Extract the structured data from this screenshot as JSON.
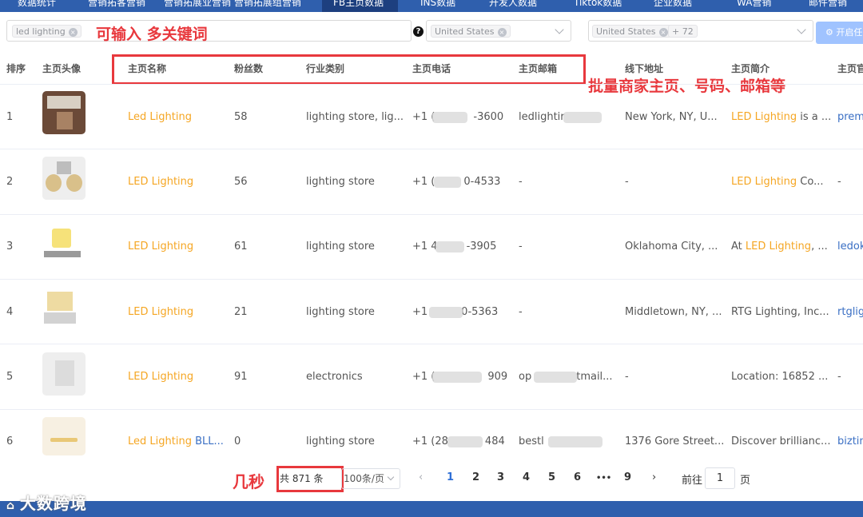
{
  "nav": {
    "tabs": [
      "数据统计",
      "营销拓客营销",
      "营销拓展业营销 营销拓展组营销",
      "FB主页数据",
      "INS数据",
      "开发人数据",
      "Tiktok数据",
      "企业数据",
      "WA营销",
      "邮件营销"
    ],
    "active_index": 3
  },
  "filters": {
    "keyword_tag": "led lighting",
    "country_select": "United States",
    "country_multi_tag": "United States",
    "country_multi_more": "+ 72",
    "start_button": "开启任"
  },
  "annotations": {
    "keywords_note": "可输入 多关键词",
    "batch_note": "批量商家主页、号码、邮箱等",
    "seconds_note": "几秒"
  },
  "table": {
    "headers": {
      "rank": "排序",
      "avatar": "主页头像",
      "name": "主页名称",
      "fans": "粉丝数",
      "industry": "行业类别",
      "phone": "主页电话",
      "email": "主页邮箱",
      "address": "线下地址",
      "intro": "主页简介",
      "homepage": "主页官"
    },
    "rows": [
      {
        "rank": "1",
        "name": "Led Lighting",
        "name_extra": "",
        "fans": "58",
        "industry": "lighting store, lig...",
        "phone_a": "+1 (",
        "phone_b": "-3600",
        "email_a": "ledlightir",
        "email_b": "",
        "address": "New York, NY, U...",
        "intro_hl": "LED Lighting",
        "intro_rest": " is a ...",
        "homepage": "prem"
      },
      {
        "rank": "2",
        "name": "LED Lighting",
        "name_extra": "",
        "fans": "56",
        "industry": "lighting store",
        "phone_a": "+1 (",
        "phone_b": "0-4533",
        "email_a": "-",
        "email_b": "",
        "address": "-",
        "intro_hl": "LED Lighting",
        "intro_rest": " Co...",
        "homepage": "-"
      },
      {
        "rank": "3",
        "name": "LED Lighting",
        "name_extra": "",
        "fans": "61",
        "industry": "lighting store",
        "phone_a": "+1 4",
        "phone_b": "-3905",
        "email_a": "-",
        "email_b": "",
        "address": "Oklahoma City, ...",
        "intro_hl": "",
        "intro_pre": "At ",
        "intro_hl2": "LED Lighting",
        "intro_rest": ", ...",
        "homepage": "ledok"
      },
      {
        "rank": "4",
        "name": "LED Lighting",
        "name_extra": "",
        "fans": "21",
        "industry": "lighting store",
        "phone_a": "+1",
        "phone_b": "0-5363",
        "email_a": "-",
        "email_b": "",
        "address": "Middletown, NY, ...",
        "intro_hl": "",
        "intro_rest": "RTG Lighting, Inc...",
        "homepage": "rtglig"
      },
      {
        "rank": "5",
        "name": "LED Lighting",
        "name_extra": "",
        "fans": "91",
        "industry": "electronics",
        "phone_a": "+1 (",
        "phone_b": "909",
        "email_a": "op",
        "email_b": "tmail...",
        "address": "-",
        "intro_hl": "",
        "intro_rest": "Location: 16852 ...",
        "homepage": "-"
      },
      {
        "rank": "6",
        "name": "Led Lighting",
        "name_extra": " BLL...",
        "fans": "0",
        "industry": "lighting store",
        "phone_a": "+1 (28",
        "phone_b": "484",
        "email_a": "bestl",
        "email_b": "",
        "address": "1376 Gore Street...",
        "intro_hl": "",
        "intro_rest": "Discover brillianc...",
        "homepage": "biztin"
      }
    ]
  },
  "pagination": {
    "total": "共 871 条",
    "page_size": "100条/页",
    "pages": [
      "1",
      "2",
      "3",
      "4",
      "5",
      "6",
      "9"
    ],
    "ellipsis": "•••",
    "current": "1",
    "prev": "‹",
    "next": "›",
    "jump_prefix": "前往",
    "jump_value": "1",
    "jump_suffix": "页"
  },
  "watermark": "大数跨境",
  "colors": {
    "accent": "#2f5fad",
    "annotation": "#e8383d",
    "highlight": "#f5a623",
    "link": "#3a6fc4"
  }
}
